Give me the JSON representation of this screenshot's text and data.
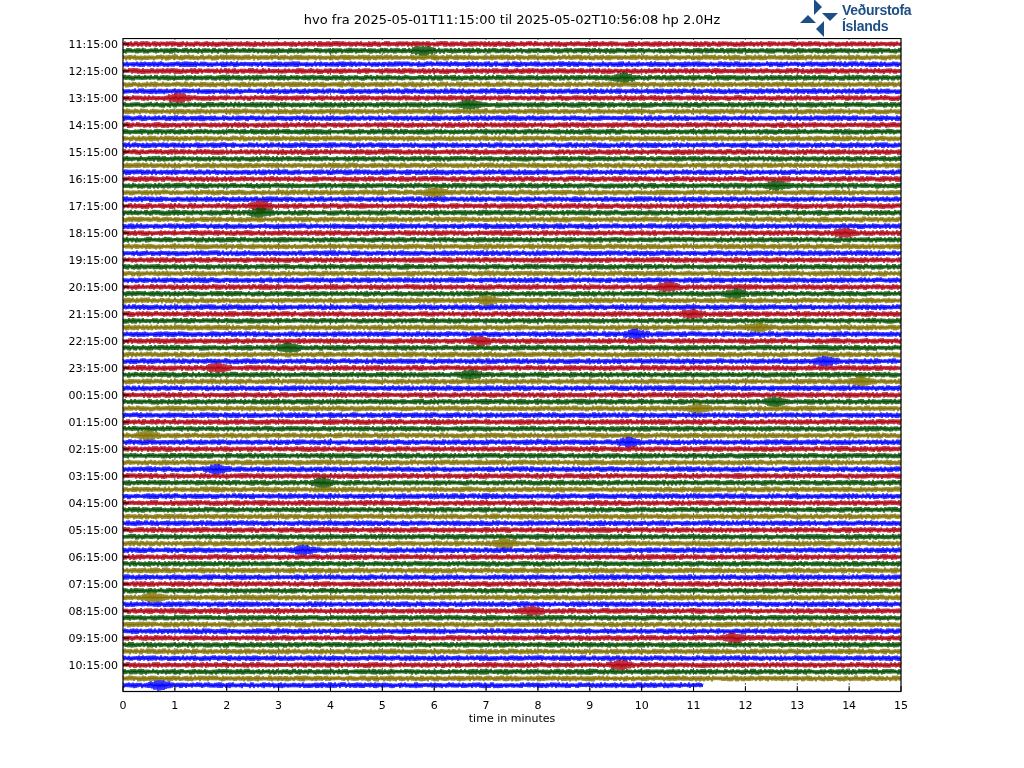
{
  "title": "hvo fra 2025-05-01T11:15:00 til 2025-05-02T10:56:08 hp 2.0Hz",
  "logo": {
    "line_1": "Veðurstofa",
    "line_2": "Íslands"
  },
  "y_tick_labels": [
    "11:15:00",
    "12:15:00",
    "13:15:00",
    "14:15:00",
    "15:15:00",
    "16:15:00",
    "17:15:00",
    "18:15:00",
    "19:15:00",
    "20:15:00",
    "21:15:00",
    "22:15:00",
    "23:15:00",
    "00:15:00",
    "01:15:00",
    "02:15:00",
    "03:15:00",
    "04:15:00",
    "05:15:00",
    "06:15:00",
    "07:15:00",
    "08:15:00",
    "09:15:00",
    "10:15:00"
  ],
  "x_tick_labels": [
    "0",
    "1",
    "2",
    "3",
    "4",
    "5",
    "6",
    "7",
    "8",
    "9",
    "10",
    "11",
    "12",
    "13",
    "14",
    "15"
  ],
  "x_axis_label": "time in minutes"
}
